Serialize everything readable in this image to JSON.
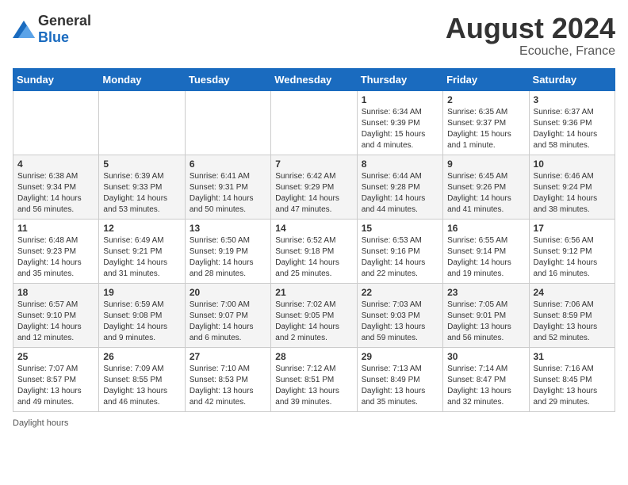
{
  "header": {
    "logo_general": "General",
    "logo_blue": "Blue",
    "month": "August 2024",
    "location": "Ecouche, France"
  },
  "days_of_week": [
    "Sunday",
    "Monday",
    "Tuesday",
    "Wednesday",
    "Thursday",
    "Friday",
    "Saturday"
  ],
  "weeks": [
    [
      {
        "date": "",
        "info": ""
      },
      {
        "date": "",
        "info": ""
      },
      {
        "date": "",
        "info": ""
      },
      {
        "date": "",
        "info": ""
      },
      {
        "date": "1",
        "info": "Sunrise: 6:34 AM\nSunset: 9:39 PM\nDaylight: 15 hours and 4 minutes."
      },
      {
        "date": "2",
        "info": "Sunrise: 6:35 AM\nSunset: 9:37 PM\nDaylight: 15 hours and 1 minute."
      },
      {
        "date": "3",
        "info": "Sunrise: 6:37 AM\nSunset: 9:36 PM\nDaylight: 14 hours and 58 minutes."
      }
    ],
    [
      {
        "date": "4",
        "info": "Sunrise: 6:38 AM\nSunset: 9:34 PM\nDaylight: 14 hours and 56 minutes."
      },
      {
        "date": "5",
        "info": "Sunrise: 6:39 AM\nSunset: 9:33 PM\nDaylight: 14 hours and 53 minutes."
      },
      {
        "date": "6",
        "info": "Sunrise: 6:41 AM\nSunset: 9:31 PM\nDaylight: 14 hours and 50 minutes."
      },
      {
        "date": "7",
        "info": "Sunrise: 6:42 AM\nSunset: 9:29 PM\nDaylight: 14 hours and 47 minutes."
      },
      {
        "date": "8",
        "info": "Sunrise: 6:44 AM\nSunset: 9:28 PM\nDaylight: 14 hours and 44 minutes."
      },
      {
        "date": "9",
        "info": "Sunrise: 6:45 AM\nSunset: 9:26 PM\nDaylight: 14 hours and 41 minutes."
      },
      {
        "date": "10",
        "info": "Sunrise: 6:46 AM\nSunset: 9:24 PM\nDaylight: 14 hours and 38 minutes."
      }
    ],
    [
      {
        "date": "11",
        "info": "Sunrise: 6:48 AM\nSunset: 9:23 PM\nDaylight: 14 hours and 35 minutes."
      },
      {
        "date": "12",
        "info": "Sunrise: 6:49 AM\nSunset: 9:21 PM\nDaylight: 14 hours and 31 minutes."
      },
      {
        "date": "13",
        "info": "Sunrise: 6:50 AM\nSunset: 9:19 PM\nDaylight: 14 hours and 28 minutes."
      },
      {
        "date": "14",
        "info": "Sunrise: 6:52 AM\nSunset: 9:18 PM\nDaylight: 14 hours and 25 minutes."
      },
      {
        "date": "15",
        "info": "Sunrise: 6:53 AM\nSunset: 9:16 PM\nDaylight: 14 hours and 22 minutes."
      },
      {
        "date": "16",
        "info": "Sunrise: 6:55 AM\nSunset: 9:14 PM\nDaylight: 14 hours and 19 minutes."
      },
      {
        "date": "17",
        "info": "Sunrise: 6:56 AM\nSunset: 9:12 PM\nDaylight: 14 hours and 16 minutes."
      }
    ],
    [
      {
        "date": "18",
        "info": "Sunrise: 6:57 AM\nSunset: 9:10 PM\nDaylight: 14 hours and 12 minutes."
      },
      {
        "date": "19",
        "info": "Sunrise: 6:59 AM\nSunset: 9:08 PM\nDaylight: 14 hours and 9 minutes."
      },
      {
        "date": "20",
        "info": "Sunrise: 7:00 AM\nSunset: 9:07 PM\nDaylight: 14 hours and 6 minutes."
      },
      {
        "date": "21",
        "info": "Sunrise: 7:02 AM\nSunset: 9:05 PM\nDaylight: 14 hours and 2 minutes."
      },
      {
        "date": "22",
        "info": "Sunrise: 7:03 AM\nSunset: 9:03 PM\nDaylight: 13 hours and 59 minutes."
      },
      {
        "date": "23",
        "info": "Sunrise: 7:05 AM\nSunset: 9:01 PM\nDaylight: 13 hours and 56 minutes."
      },
      {
        "date": "24",
        "info": "Sunrise: 7:06 AM\nSunset: 8:59 PM\nDaylight: 13 hours and 52 minutes."
      }
    ],
    [
      {
        "date": "25",
        "info": "Sunrise: 7:07 AM\nSunset: 8:57 PM\nDaylight: 13 hours and 49 minutes."
      },
      {
        "date": "26",
        "info": "Sunrise: 7:09 AM\nSunset: 8:55 PM\nDaylight: 13 hours and 46 minutes."
      },
      {
        "date": "27",
        "info": "Sunrise: 7:10 AM\nSunset: 8:53 PM\nDaylight: 13 hours and 42 minutes."
      },
      {
        "date": "28",
        "info": "Sunrise: 7:12 AM\nSunset: 8:51 PM\nDaylight: 13 hours and 39 minutes."
      },
      {
        "date": "29",
        "info": "Sunrise: 7:13 AM\nSunset: 8:49 PM\nDaylight: 13 hours and 35 minutes."
      },
      {
        "date": "30",
        "info": "Sunrise: 7:14 AM\nSunset: 8:47 PM\nDaylight: 13 hours and 32 minutes."
      },
      {
        "date": "31",
        "info": "Sunrise: 7:16 AM\nSunset: 8:45 PM\nDaylight: 13 hours and 29 minutes."
      }
    ]
  ],
  "footer": {
    "daylight_label": "Daylight hours"
  }
}
